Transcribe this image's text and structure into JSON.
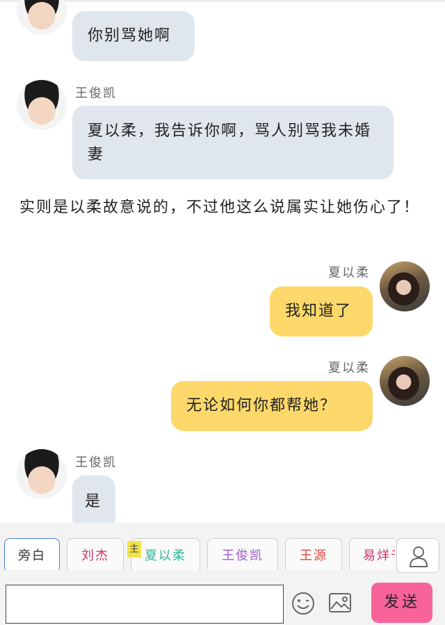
{
  "messages": [
    {
      "speaker": "",
      "text": "你别骂她啊"
    },
    {
      "speaker": "王俊凯",
      "text": "夏以柔，我告诉你啊，骂人别骂我未婚妻"
    },
    {
      "speaker": "夏以柔",
      "text": "我知道了"
    },
    {
      "speaker": "夏以柔",
      "text": "无论如何你都帮她？"
    },
    {
      "speaker": "王俊凯",
      "text": "是"
    }
  ],
  "narration": "实则是以柔故意说的，不过他这么说属实让她伤心了！",
  "characters": [
    {
      "label": "旁白",
      "color": "#333333",
      "selected": true
    },
    {
      "label": "刘杰",
      "color": "#d0306a"
    },
    {
      "label": "夏以柔",
      "color": "#2fb89a",
      "tag": "主"
    },
    {
      "label": "王俊凯",
      "color": "#9a5cc6"
    },
    {
      "label": "王源",
      "color": "#e0453a"
    },
    {
      "label": "易烊千",
      "color": "#d0306a"
    }
  ],
  "input": {
    "placeholder": ""
  },
  "send_label": "发送",
  "colors": {
    "left_bubble": "#e0e6ee",
    "right_bubble": "#fcd86a",
    "send": "#f8649a"
  },
  "icons": {
    "person": "person-icon",
    "emoji": "smiley-icon",
    "image": "image-icon"
  }
}
